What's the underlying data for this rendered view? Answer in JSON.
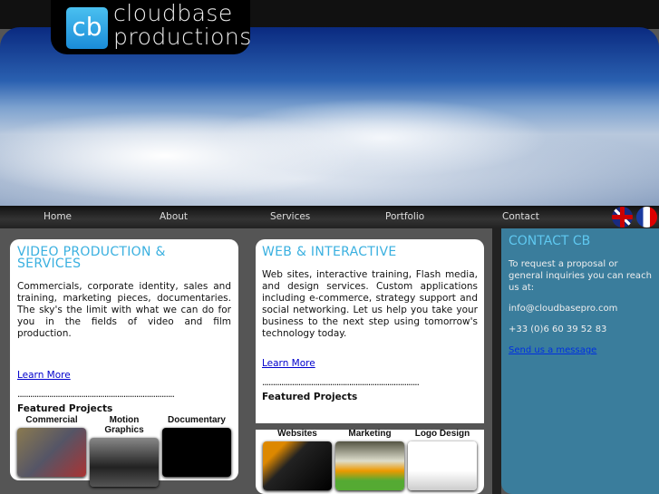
{
  "logo": {
    "badge": "cb",
    "line1": "cloudbase",
    "line2": "productions"
  },
  "nav": [
    "Home",
    "About",
    "Services",
    "Portfolio",
    "Contact"
  ],
  "languages": [
    "English",
    "Français"
  ],
  "video": {
    "title": "VIDEO PRODUCTION & SERVICES",
    "body": "Commercials, corporate identity, sales and training, marketing pieces, documentaries. The sky's the limit with what we can do for you in the fields of video and film production.",
    "link": "Learn More",
    "dots": "..........................................................................",
    "featured": "Featured Projects",
    "projects": [
      "Commercial",
      "Motion Graphics",
      "Documentary"
    ]
  },
  "web": {
    "title": "WEB & INTERACTIVE",
    "body": "Web sites, interactive training, Flash media, and design services. Custom applications including e-commerce, strategy support and social networking. Let us help you take your business to the next step using tomorrow's technology today.",
    "link": "Learn More",
    "dots": "..........................................................................",
    "featured": "Featured Projects",
    "projects": [
      "Websites",
      "Marketing",
      "Logo Design"
    ]
  },
  "contact": {
    "title": "CONTACT CB",
    "intro": "To request a proposal or general inquiries you can reach us at:",
    "email": "info@cloudbasepro.com",
    "phone": "+33 (0)6 60 39 52 83",
    "link": "Send us a message"
  }
}
